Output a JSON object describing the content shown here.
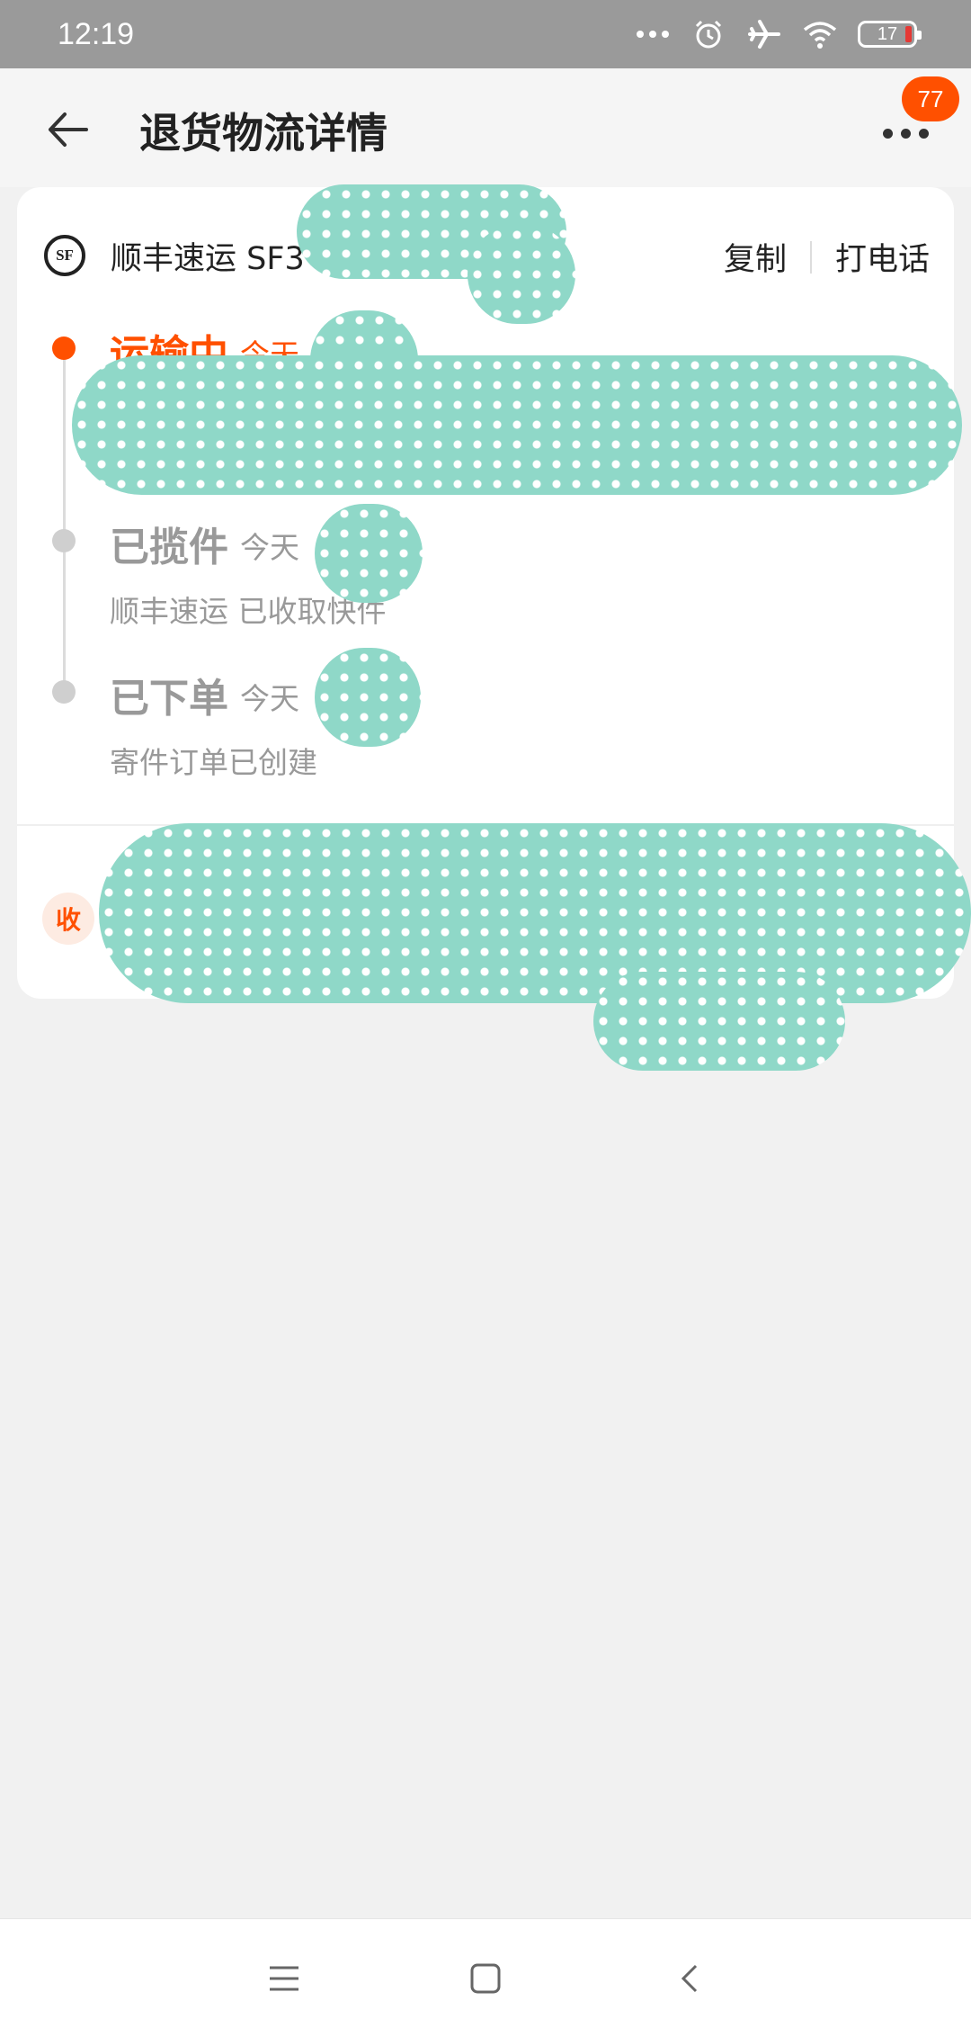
{
  "status_bar": {
    "time": "12:19",
    "battery": "17",
    "icons": [
      "more-dots-icon",
      "alarm-icon",
      "airplane-icon",
      "wifi-icon",
      "battery-icon"
    ]
  },
  "header": {
    "title": "退货物流详情",
    "badge_count": "77",
    "icons": [
      "back-arrow-icon",
      "more-icon"
    ]
  },
  "carrier": {
    "logo_text": "SF",
    "name": "顺丰速运 SF3",
    "copy_label": "复制",
    "call_label": "打电话"
  },
  "timeline": [
    {
      "status": "运输中",
      "time": "今天",
      "description": "",
      "active": true
    },
    {
      "status": "已揽件",
      "time": "今天",
      "description": "顺丰速运 已收取快件",
      "active": false
    },
    {
      "status": "已下单",
      "time": "今天",
      "description": "寄件订单已创建",
      "active": false
    }
  ],
  "receiver": {
    "icon_label": "收"
  },
  "nav_bar": {
    "icons": [
      "menu-icon",
      "home-icon",
      "back-icon"
    ]
  },
  "colors": {
    "accent": "#ff5000",
    "muted": "#999999",
    "background": "#f1f1f1",
    "redaction": "#8fd8c8"
  }
}
